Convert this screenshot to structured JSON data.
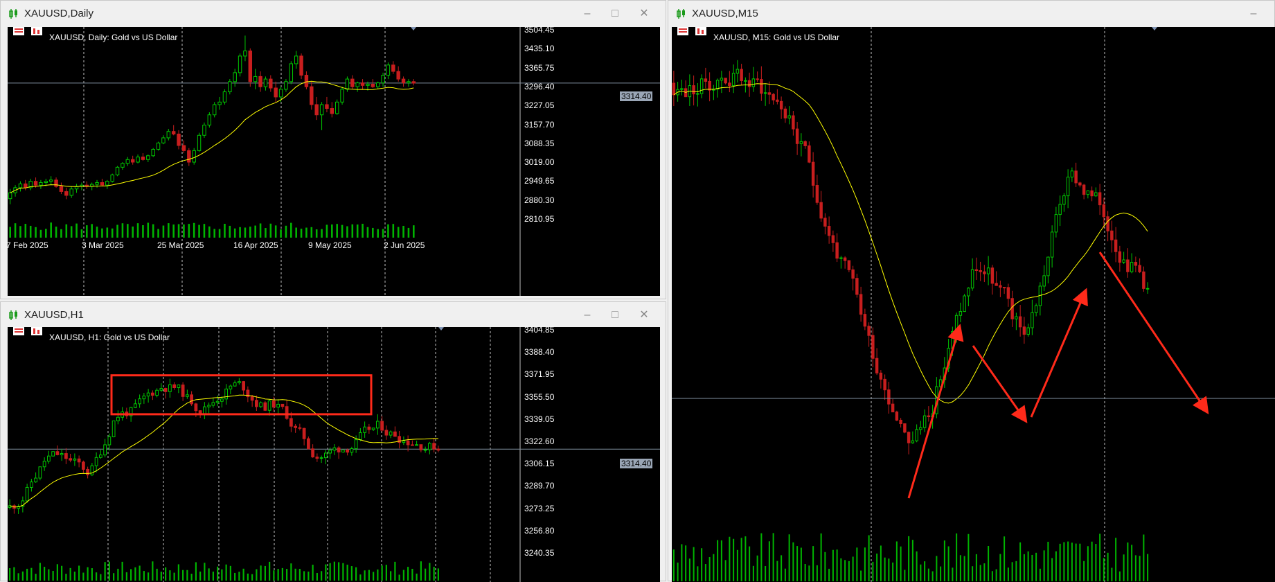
{
  "windows": {
    "daily": {
      "title": "XAUUSD,Daily",
      "label": "XAUUSD, Daily:  Gold vs US Dollar",
      "current_price": "3314.40",
      "price_labels": [
        "3504.45",
        "3435.10",
        "3365.75",
        "3296.40",
        "3227.05",
        "3157.70",
        "3088.35",
        "3019.00",
        "2949.65",
        "2880.30",
        "2810.95"
      ],
      "date_labels": [
        "7 Feb 2025",
        "3 Mar 2025",
        "25 Mar 2025",
        "16 Apr 2025",
        "9 May 2025",
        "2 Jun 2025"
      ]
    },
    "h1": {
      "title": "XAUUSD,H1",
      "label": "XAUUSD, H1:  Gold vs US Dollar",
      "current_price": "3314.40",
      "price_labels": [
        "3404.85",
        "3388.40",
        "3371.95",
        "3355.50",
        "3339.05",
        "3322.60",
        "3306.15",
        "3289.70",
        "3273.25",
        "3256.80",
        "3240.35"
      ]
    },
    "m15": {
      "title": "XAUUSD,M15",
      "label": "XAUUSD, M15:  Gold vs US Dollar"
    }
  },
  "colors": {
    "bull": "#00c800",
    "bear": "#c81e1e",
    "ma": "#ffff00",
    "grid": "#c0c0c0",
    "annot": "#ff2a1a",
    "volume": "#00b400"
  },
  "icons": {
    "app": "candlestick-icon",
    "minimize": "minimize-icon",
    "maximize": "maximize-icon",
    "close": "close-icon"
  },
  "chart_data": [
    {
      "type": "candlestick",
      "name": "XAUUSD Daily",
      "ylim": [
        2780,
        3520
      ],
      "x": [
        "7 Feb 2025",
        "3 Mar 2025",
        "25 Mar 2025",
        "16 Apr 2025",
        "9 May 2025",
        "2 Jun 2025"
      ],
      "ohlc": [
        [
          2862,
          2900,
          2840,
          2885
        ],
        [
          2885,
          2915,
          2870,
          2905
        ],
        [
          2905,
          2930,
          2890,
          2920
        ],
        [
          2920,
          2935,
          2895,
          2905
        ],
        [
          2905,
          2940,
          2895,
          2930
        ],
        [
          2930,
          2945,
          2905,
          2915
        ],
        [
          2915,
          2935,
          2900,
          2925
        ],
        [
          2925,
          2940,
          2910,
          2930
        ],
        [
          2930,
          2950,
          2915,
          2935
        ],
        [
          2935,
          2945,
          2905,
          2910
        ],
        [
          2910,
          2925,
          2880,
          2890
        ],
        [
          2890,
          2905,
          2860,
          2875
        ],
        [
          2875,
          2910,
          2865,
          2900
        ],
        [
          2900,
          2920,
          2885,
          2910
        ],
        [
          2910,
          2925,
          2895,
          2915
        ],
        [
          2915,
          2930,
          2900,
          2910
        ],
        [
          2910,
          2925,
          2895,
          2918
        ],
        [
          2918,
          2935,
          2905,
          2925
        ],
        [
          2925,
          2940,
          2910,
          2915
        ],
        [
          2915,
          2935,
          2900,
          2930
        ],
        [
          2930,
          2960,
          2925,
          2955
        ],
        [
          2955,
          2990,
          2950,
          2985
        ],
        [
          2985,
          3005,
          2975,
          3000
        ],
        [
          3000,
          3025,
          2990,
          3015
        ],
        [
          3015,
          3030,
          2995,
          3005
        ],
        [
          3005,
          3035,
          3000,
          3025
        ],
        [
          3025,
          3040,
          3010,
          3015
        ],
        [
          3015,
          3035,
          3005,
          3030
        ],
        [
          3030,
          3060,
          3025,
          3055
        ],
        [
          3055,
          3085,
          3050,
          3080
        ],
        [
          3080,
          3110,
          3075,
          3100
        ],
        [
          3100,
          3135,
          3090,
          3125
        ],
        [
          3125,
          3150,
          3110,
          3115
        ],
        [
          3115,
          3130,
          3055,
          3070
        ],
        [
          3070,
          3090,
          3040,
          3050
        ],
        [
          3050,
          3060,
          2990,
          3005
        ],
        [
          3005,
          3060,
          2995,
          3050
        ],
        [
          3050,
          3120,
          3045,
          3110
        ],
        [
          3110,
          3160,
          3100,
          3150
        ],
        [
          3150,
          3200,
          3140,
          3190
        ],
        [
          3190,
          3240,
          3180,
          3230
        ],
        [
          3230,
          3260,
          3210,
          3240
        ],
        [
          3240,
          3290,
          3230,
          3280
        ],
        [
          3280,
          3330,
          3270,
          3320
        ],
        [
          3320,
          3370,
          3300,
          3355
        ],
        [
          3355,
          3430,
          3340,
          3420
        ],
        [
          3420,
          3500,
          3400,
          3440
        ],
        [
          3440,
          3450,
          3300,
          3320
        ],
        [
          3320,
          3370,
          3290,
          3340
        ],
        [
          3340,
          3360,
          3280,
          3300
        ],
        [
          3300,
          3340,
          3285,
          3330
        ],
        [
          3330,
          3345,
          3280,
          3295
        ],
        [
          3295,
          3320,
          3240,
          3260
        ],
        [
          3260,
          3300,
          3240,
          3290
        ],
        [
          3290,
          3330,
          3280,
          3320
        ],
        [
          3320,
          3400,
          3310,
          3390
        ],
        [
          3390,
          3440,
          3370,
          3420
        ],
        [
          3420,
          3430,
          3330,
          3345
        ],
        [
          3345,
          3360,
          3290,
          3300
        ],
        [
          3300,
          3320,
          3210,
          3230
        ],
        [
          3230,
          3260,
          3170,
          3190
        ],
        [
          3190,
          3240,
          3130,
          3230
        ],
        [
          3230,
          3260,
          3200,
          3215
        ],
        [
          3215,
          3240,
          3180,
          3195
        ],
        [
          3195,
          3250,
          3190,
          3240
        ],
        [
          3240,
          3300,
          3230,
          3290
        ],
        [
          3290,
          3340,
          3280,
          3330
        ],
        [
          3330,
          3345,
          3290,
          3300
        ],
        [
          3300,
          3320,
          3280,
          3315
        ],
        [
          3315,
          3330,
          3290,
          3305
        ],
        [
          3305,
          3320,
          3285,
          3310
        ],
        [
          3310,
          3330,
          3295,
          3300
        ],
        [
          3300,
          3320,
          3290,
          3315
        ],
        [
          3315,
          3355,
          3300,
          3345
        ],
        [
          3345,
          3395,
          3330,
          3385
        ],
        [
          3385,
          3400,
          3350,
          3360
        ],
        [
          3360,
          3380,
          3320,
          3330
        ],
        [
          3330,
          3340,
          3300,
          3315
        ],
        [
          3315,
          3330,
          3300,
          3320
        ],
        [
          3320,
          3330,
          3305,
          3314
        ]
      ],
      "ma_period": 20
    },
    {
      "type": "candlestick",
      "name": "XAUUSD H1",
      "ylim": [
        3230,
        3415
      ],
      "annotation": {
        "type": "rectangle",
        "from_index": 24,
        "to_index": 84,
        "top": 3377,
        "bottom": 3344
      },
      "seed": 11,
      "ma_period": 20
    },
    {
      "type": "candlestick",
      "name": "XAUUSD M15",
      "annotations": [
        {
          "type": "arrow",
          "from": [
            37,
            0.16
          ],
          "to": [
            46,
            0.78
          ]
        },
        {
          "type": "arrow",
          "from": [
            51,
            0.44
          ],
          "to": [
            61,
            0.3
          ]
        },
        {
          "type": "arrow",
          "from": [
            62,
            0.3
          ],
          "to": [
            70,
            0.7
          ]
        },
        {
          "type": "arrow",
          "from": [
            74,
            0.64
          ],
          "to": [
            89,
            0.33
          ]
        }
      ],
      "seed": 23,
      "ma_period": 20
    }
  ]
}
